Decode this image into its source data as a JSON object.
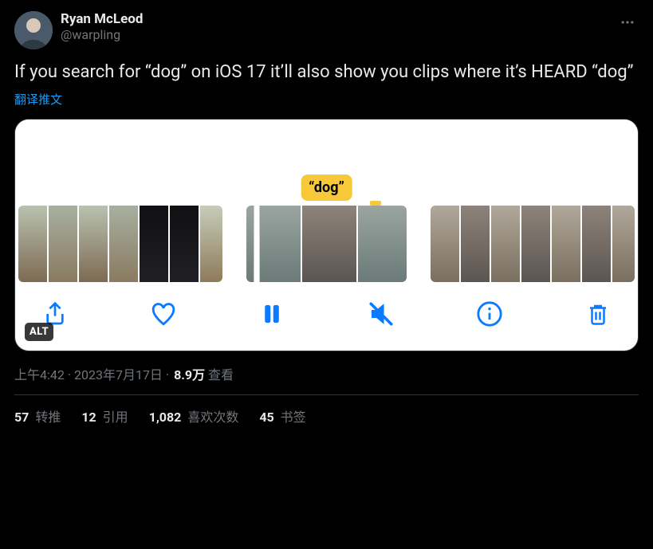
{
  "author": {
    "display_name": "Ryan McLeod",
    "handle": "@warpling"
  },
  "tweet_text": "If you search for “dog” on iOS 17 it’ll also show you clips where it’s HEARD “dog”",
  "translate_link": "翻译推文",
  "media": {
    "highlight_label": "“dog”",
    "alt_badge": "ALT",
    "controls": {
      "share": "share-icon",
      "like": "heart-icon",
      "pause": "pause-icon",
      "mute": "mute-icon",
      "info": "info-icon",
      "trash": "trash-icon"
    }
  },
  "meta": {
    "time": "上午4:42",
    "dot1": " · ",
    "date": "2023年7月17日",
    "dot2": " · ",
    "views_count": "8.9万",
    "views_label": " 查看"
  },
  "stats": {
    "retweets_count": "57",
    "retweets_label": " 转推",
    "quotes_count": "12",
    "quotes_label": " 引用",
    "likes_count": "1,082",
    "likes_label": " 喜欢次数",
    "bookmarks_count": "45",
    "bookmarks_label": " 书签"
  }
}
